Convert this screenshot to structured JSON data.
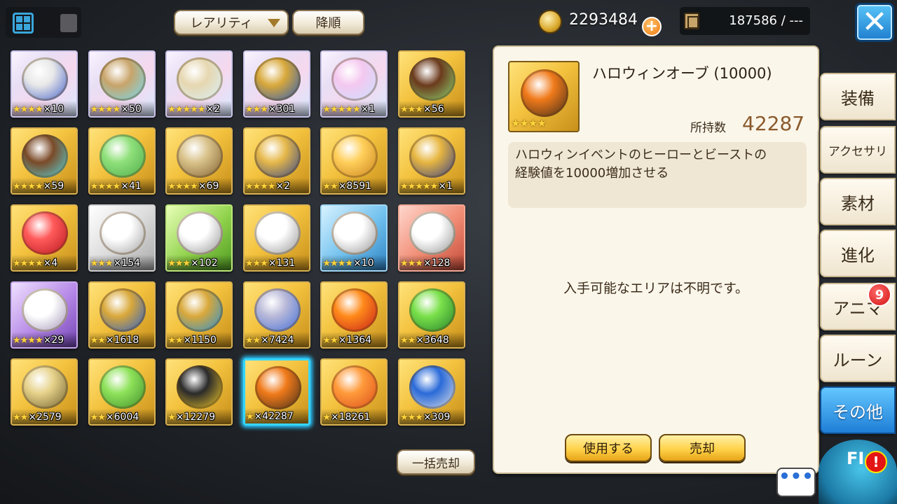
{
  "toolbar": {
    "rarity_label": "レアリティ",
    "order_label": "降順"
  },
  "currency": {
    "coins": "2293484",
    "book_count": "187586 / ---"
  },
  "items": [
    {
      "stars": 4,
      "count": "×10",
      "rarity": "plat",
      "icon": "orb-cluster-icon",
      "colors": [
        "#e8e8e8",
        "#3a59c8"
      ]
    },
    {
      "stars": 4,
      "count": "×50",
      "rarity": "plat",
      "icon": "crystal-scepter-icon",
      "colors": [
        "#c8a46a",
        "#6ee0ff"
      ]
    },
    {
      "stars": 5,
      "count": "×2",
      "rarity": "plat",
      "icon": "hand-mirror-icon",
      "colors": [
        "#e6d7b0",
        "#d9f2ff"
      ]
    },
    {
      "stars": 3,
      "count": "×301",
      "rarity": "plat",
      "icon": "armillary-orb-icon",
      "colors": [
        "#d8a83a",
        "#2258c2"
      ]
    },
    {
      "stars": 5,
      "count": "×1",
      "rarity": "plat",
      "icon": "blank-crystal-icon",
      "colors": [
        "#f4c8f0",
        "#c7e3ff"
      ]
    },
    {
      "stars": 3,
      "count": "×56",
      "rarity": "gold",
      "icon": "seed-cluster-icon",
      "colors": [
        "#6b3a1c",
        "#8ee27a"
      ]
    },
    {
      "stars": 4,
      "count": "×59",
      "rarity": "gold",
      "icon": "gem-staff-icon",
      "colors": [
        "#7a4a28",
        "#56e0e8"
      ]
    },
    {
      "stars": 4,
      "count": "×41",
      "rarity": "gold",
      "icon": "green-fruit-icon",
      "colors": [
        "#8fe07a",
        "#4aa848"
      ]
    },
    {
      "stars": 4,
      "count": "×69",
      "rarity": "gold",
      "icon": "round-pouch-icon",
      "colors": [
        "#d9c28a",
        "#7a5a2a"
      ]
    },
    {
      "stars": 4,
      "count": "×2",
      "rarity": "gold",
      "icon": "bell-ornament-icon",
      "colors": [
        "#e6b84a",
        "#2a3f8c"
      ]
    },
    {
      "stars": 2,
      "count": "×8591",
      "rarity": "gold",
      "icon": "gold-bar-icon",
      "colors": [
        "#ffcf5a",
        "#c77e1a"
      ]
    },
    {
      "stars": 5,
      "count": "×1",
      "rarity": "gold",
      "icon": "war-hammer-icon",
      "colors": [
        "#e7b640",
        "#2e3a8c"
      ]
    },
    {
      "stars": 4,
      "count": "×4",
      "rarity": "gold",
      "icon": "red-crystal-icon",
      "colors": [
        "#ff5a5a",
        "#b3141c"
      ]
    },
    {
      "stars": 3,
      "count": "×154",
      "rarity": "silver",
      "icon": "hero-bust-icon",
      "colors": [
        "#ffffff",
        "#9a9a9a"
      ]
    },
    {
      "stars": 3,
      "count": "×102",
      "rarity": "green",
      "icon": "elf-bust-icon",
      "colors": [
        "#ffffff",
        "#8c8c8c"
      ]
    },
    {
      "stars": 3,
      "count": "×131",
      "rarity": "gold",
      "icon": "cat-bust-icon",
      "colors": [
        "#ffffff",
        "#8c8c8c"
      ]
    },
    {
      "stars": 4,
      "count": "×10",
      "rarity": "blue",
      "icon": "knight-bust-icon",
      "colors": [
        "#ffffff",
        "#8c8c8c"
      ]
    },
    {
      "stars": 3,
      "count": "×128",
      "rarity": "red",
      "icon": "beast-bust-icon",
      "colors": [
        "#ffffff",
        "#8c8c8c"
      ]
    },
    {
      "stars": 4,
      "count": "×29",
      "rarity": "purple",
      "icon": "rabbit-bust-icon",
      "colors": [
        "#ffffff",
        "#9a8ab0"
      ]
    },
    {
      "stars": 2,
      "count": "×1618",
      "rarity": "gold",
      "icon": "blue-egg-icon",
      "colors": [
        "#d9a83a",
        "#1f5ad1"
      ]
    },
    {
      "stars": 2,
      "count": "×1150",
      "rarity": "gold",
      "icon": "blue-gem-orbit-icon",
      "colors": [
        "#d9a83a",
        "#1a8fe0"
      ]
    },
    {
      "stars": 2,
      "count": "×7424",
      "rarity": "gold",
      "icon": "winged-gem-icon",
      "colors": [
        "#b8b8d8",
        "#3a6ad8"
      ]
    },
    {
      "stars": 2,
      "count": "×1364",
      "rarity": "gold",
      "icon": "fire-gem-icon",
      "colors": [
        "#ff8a1a",
        "#c21a1a"
      ]
    },
    {
      "stars": 2,
      "count": "×3648",
      "rarity": "gold",
      "icon": "leaf-gem-icon",
      "colors": [
        "#7ae04a",
        "#1f7a2a"
      ]
    },
    {
      "stars": 2,
      "count": "×2579",
      "rarity": "gold",
      "icon": "gold-star-orb-icon",
      "colors": [
        "#e6d28a",
        "#6a5a2a"
      ]
    },
    {
      "stars": 2,
      "count": "×6004",
      "rarity": "gold",
      "icon": "green-orb-icon",
      "colors": [
        "#8ee25a",
        "#3a8a28"
      ]
    },
    {
      "stars": 1,
      "count": "×12279",
      "rarity": "gold",
      "icon": "number-orb-icon",
      "colors": [
        "#2a2a2a",
        "#ffd42a"
      ]
    },
    {
      "stars": 1,
      "count": "×42287",
      "rarity": "gold",
      "icon": "pumpkin-orb-icon",
      "colors": [
        "#f07a1a",
        "#3a2a1a"
      ],
      "selected": true
    },
    {
      "stars": 1,
      "count": "×18261",
      "rarity": "gold",
      "icon": "sun-orb-icon",
      "colors": [
        "#ff9a3a",
        "#d84a1a"
      ]
    },
    {
      "stars": 3,
      "count": "×309",
      "rarity": "gold",
      "icon": "santa-orb-icon",
      "colors": [
        "#2a6ad8",
        "#e8e8e8"
      ]
    }
  ],
  "detail": {
    "name": "ハロウィンオーブ (10000)",
    "stars": "★★★★",
    "owned_label": "所持数",
    "owned_value": "42287",
    "description_line1": "ハロウィンイベントのヒーローとビーストの",
    "description_line2": "経験値を10000増加させる",
    "area_text": "入手可能なエリアは不明です。",
    "use_label": "使用する",
    "sell_label": "売却",
    "icon": "pumpkin-orb-icon"
  },
  "bulk_sell_label": "一括売却",
  "categories": [
    {
      "label": "装備"
    },
    {
      "label": "アクセサリ"
    },
    {
      "label": "素材"
    },
    {
      "label": "進化"
    },
    {
      "label": "アニマ"
    },
    {
      "label": "ルーン"
    },
    {
      "label": "その他",
      "active": true
    }
  ],
  "anima_badge": "9",
  "mascot_label": "FI",
  "chat_label": "•••",
  "colors": {
    "accent_blue": "#1e7ed6",
    "selection_cyan": "#36d6ff",
    "star_gold": "#ffd43b",
    "owned_value": "#8a5a2c"
  }
}
